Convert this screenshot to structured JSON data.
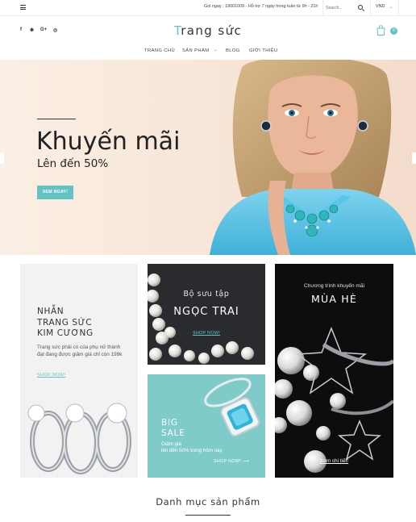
{
  "topbar": {
    "hotline": "Gọi ngay : 19001009 - Hỗ trợ 7 ngày trong tuần từ 9h - 21h",
    "search_placeholder": "Search...",
    "currency": "VND"
  },
  "header": {
    "logo_first": "T",
    "logo_rest": "rang sức",
    "social": [
      "f",
      "✱",
      "G+",
      "◎"
    ],
    "cart_count": "0"
  },
  "nav": {
    "items": [
      "TRANG CHỦ",
      "SẢN PHẨM",
      "BLOG",
      "GIỚI THIỆU"
    ]
  },
  "hero": {
    "title": "Khuyến mãi",
    "subtitle": "Lên đến 50%",
    "cta": "XEM NGAY!"
  },
  "banners": {
    "b1": {
      "title_lines": [
        "NHẪN",
        "TRANG SỨC",
        "KIM CƯƠNG"
      ],
      "desc": "Trang sức phải có của phụ nữ thành đạt đang được giảm giá chỉ còn 199k",
      "link": "SHOP NOW!"
    },
    "b2": {
      "subtitle": "Bộ sưu tập",
      "title": "NGỌC TRAI",
      "link": "SHOP NOW!"
    },
    "b3": {
      "title_lines": [
        "BIG",
        "SALE"
      ],
      "desc_lines": [
        "Giảm giá",
        "lên đến 50% trong hôm nay"
      ],
      "link": "SHOP NOW!"
    },
    "b4": {
      "subtitle": "Chương trình khuyến mãi",
      "title": "MÙA HÈ",
      "link": "Xem chi tiết!"
    }
  },
  "section": {
    "title": "Danh mục sản phẩm"
  },
  "colors": {
    "accent": "#64c2c4",
    "text": "#333333"
  }
}
